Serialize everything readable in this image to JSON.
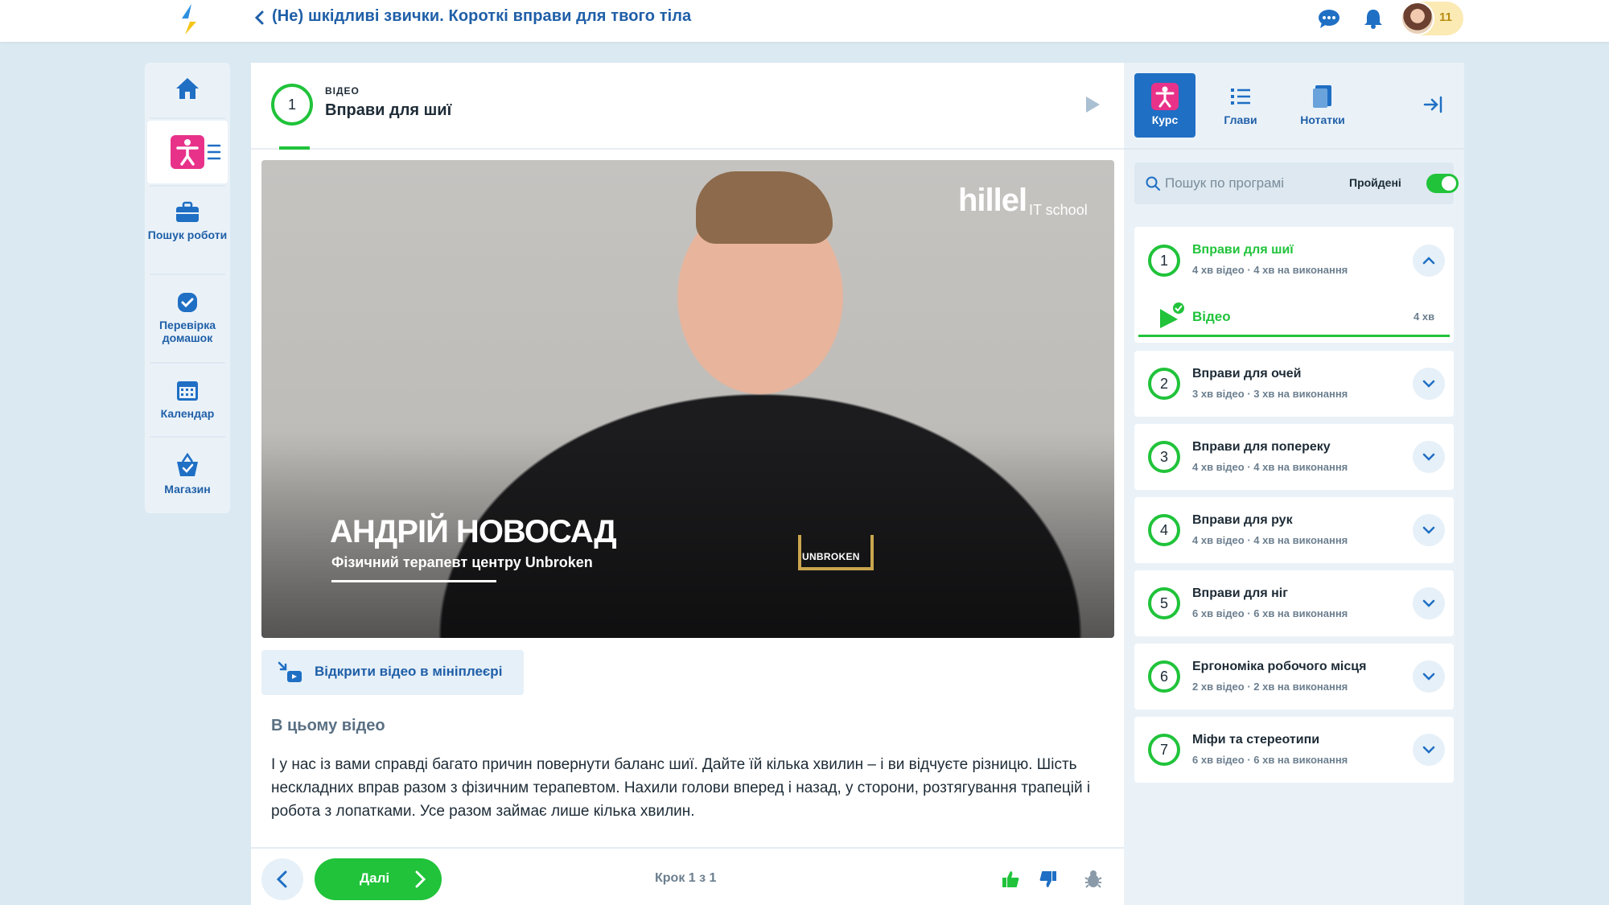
{
  "header": {
    "course_title": "(Не) шкідливі звички. Короткі вправи для твого тіла",
    "notifications_count": "11"
  },
  "leftnav": {
    "items": [
      {
        "label": "",
        "icon": "home-icon"
      },
      {
        "label": "",
        "icon": "course-accessibility-icon"
      },
      {
        "label": "Пошук роботи",
        "icon": "briefcase-icon"
      },
      {
        "label": "Перевірка домашок",
        "icon": "check-circle-icon"
      },
      {
        "label": "Календар",
        "icon": "calendar-icon"
      },
      {
        "label": "Магазин",
        "icon": "shop-basket-icon"
      }
    ]
  },
  "step": {
    "number": "1",
    "kind": "ВІДЕО",
    "title": "Вправи для шиї"
  },
  "video": {
    "brand": "hillel",
    "brand_sub": "IT school",
    "speaker_name": "АНДРІЙ НОВОСАД",
    "speaker_role": "Фізичний терапевт центру Unbroken",
    "shirt_text": "UNBROKEN"
  },
  "mini_player_label": "Відкрити відео в мініплеєрі",
  "description": {
    "title": "В цьому відео",
    "text": "І у нас із вами справді багато причин повернути баланс шиї. Дайте їй кілька хвилин – і ви відчуєте різницю. Шість нескладних вправ разом з фізичним терапевтом. Нахили голови вперед і назад, у сторони, розтягування трапецій і робота з лопатками. Усе разом займає лише кілька хвилин."
  },
  "bottombar": {
    "next_label": "Далі",
    "step_counter": "Крок 1 з 1"
  },
  "rightpanel": {
    "tabs": [
      {
        "label": "Курс",
        "icon": "course-icon",
        "active": true
      },
      {
        "label": "Глави",
        "icon": "list-icon",
        "active": false
      },
      {
        "label": "Нотатки",
        "icon": "notes-icon",
        "active": false
      }
    ],
    "search_placeholder": "Пошук по програмі",
    "toggle_label": "Пройдені",
    "chapters": [
      {
        "num": "1",
        "title": "Вправи для шиї",
        "meta": "4 хв відео · 4 хв на виконання",
        "expanded": true
      },
      {
        "num": "2",
        "title": "Вправи для очей",
        "meta": "3 хв відео · 3 хв на виконання"
      },
      {
        "num": "3",
        "title": "Вправи для попереку",
        "meta": "4 хв відео · 4 хв на виконання"
      },
      {
        "num": "4",
        "title": "Вправи для рук",
        "meta": "4 хв відео · 4 хв на виконання"
      },
      {
        "num": "5",
        "title": "Вправи для ніг",
        "meta": "6 хв відео · 6 хв на виконання"
      },
      {
        "num": "6",
        "title": "Ергономіка робочого місця",
        "meta": "2 хв відео · 2 хв на виконання"
      },
      {
        "num": "7",
        "title": "Міфи та стереотипи",
        "meta": "6 хв відео · 6 хв на виконання"
      }
    ],
    "sub_item": {
      "label": "Відео",
      "duration": "4 хв"
    }
  },
  "colors": {
    "accent_green": "#20c33a",
    "brand_blue": "#1f5fa8",
    "active_tab_blue": "#1f6fc4",
    "course_pink": "#e8328a"
  }
}
